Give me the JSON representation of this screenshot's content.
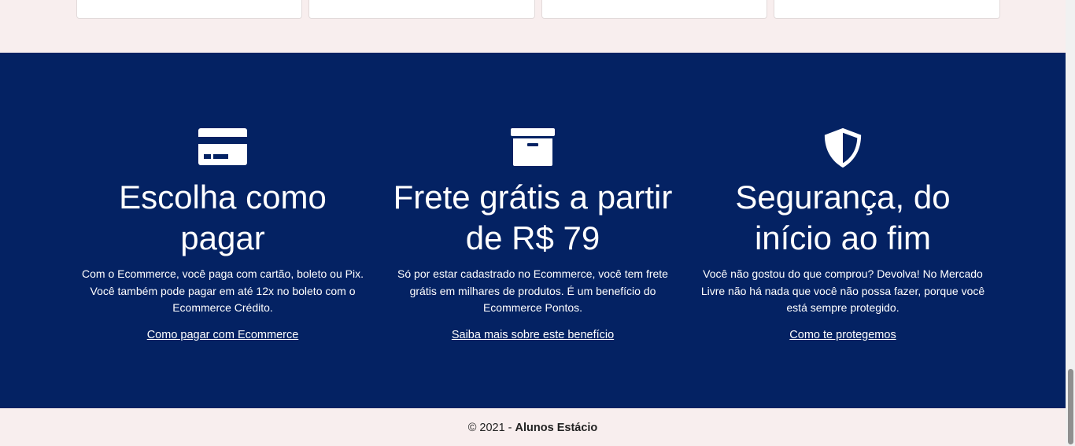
{
  "features": [
    {
      "icon": "credit-card-icon",
      "title": "Escolha como pagar",
      "text": "Com o Ecommerce, você paga com cartão, boleto ou Pix. Você também pode pagar em até 12x no boleto com o Ecommerce Crédito.",
      "link": "Como pagar com Ecommerce"
    },
    {
      "icon": "archive-box-icon",
      "title": "Frete grátis a partir de R$ 79",
      "text": "Só por estar cadastrado no Ecommerce, você tem frete grátis em milhares de produtos. É um benefício do Ecommerce Pontos.",
      "link": "Saiba mais sobre este benefício"
    },
    {
      "icon": "shield-icon",
      "title": "Segurança, do início ao fim",
      "text": "Você não gostou do que comprou? Devolva! No Mercado Livre não há nada que você não possa fazer, porque você está sempre protegido.",
      "link": "Como te protegemos"
    }
  ],
  "footer": {
    "prefix": "© 2021 - ",
    "author": "Alunos Estácio"
  },
  "colors": {
    "features_bg": "#042263",
    "page_bg": "#f8eeee"
  }
}
